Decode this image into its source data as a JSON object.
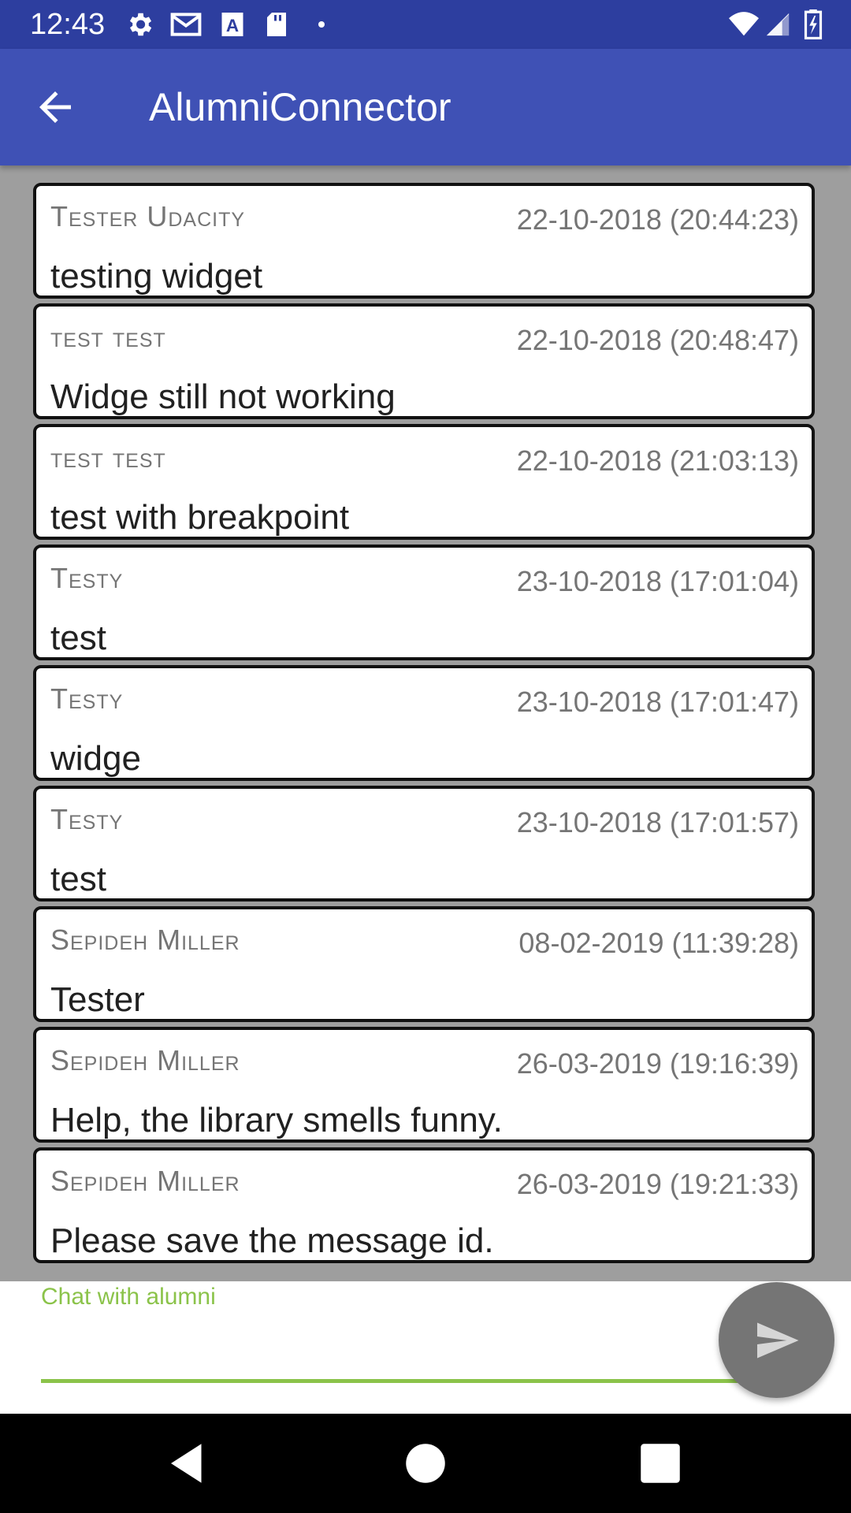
{
  "status_bar": {
    "time": "12:43",
    "icons_left": [
      "settings-icon",
      "gmail-icon",
      "font-a-icon",
      "sd-card-icon",
      "dot-icon"
    ],
    "icons_right": [
      "wifi-icon",
      "signal-icon",
      "battery-icon"
    ]
  },
  "app_bar": {
    "title": "AlumniConnector",
    "back_icon": "arrow-back-icon"
  },
  "messages": [
    {
      "author": "Tester Udacity",
      "time": "22-10-2018 (20:44:23)",
      "text": "testing widget"
    },
    {
      "author": "test test",
      "time": "22-10-2018 (20:48:47)",
      "text": "Widge still not working"
    },
    {
      "author": "test test",
      "time": "22-10-2018 (21:03:13)",
      "text": "test with breakpoint"
    },
    {
      "author": "Testy",
      "time": "23-10-2018 (17:01:04)",
      "text": "test"
    },
    {
      "author": "Testy",
      "time": "23-10-2018 (17:01:47)",
      "text": "widge"
    },
    {
      "author": "Testy",
      "time": "23-10-2018 (17:01:57)",
      "text": "test"
    },
    {
      "author": "Sepideh Miller",
      "time": "08-02-2019 (11:39:28)",
      "text": "Tester"
    },
    {
      "author": "Sepideh Miller",
      "time": "26-03-2019 (19:16:39)",
      "text": "Help, the library smells funny."
    },
    {
      "author": "Sepideh Miller",
      "time": "26-03-2019 (19:21:33)",
      "text": "Please save the message id."
    }
  ],
  "input": {
    "hint": "Chat with alumni",
    "value": ""
  },
  "send_button": {
    "icon": "send-icon"
  },
  "nav_bar": {
    "icons": [
      "nav-back-icon",
      "nav-home-icon",
      "nav-recents-icon"
    ]
  },
  "colors": {
    "status_bar": "#2d3e9f",
    "app_bar": "#3f51b5",
    "list_background": "#9e9e9e",
    "accent": "#8bc34a",
    "fab": "#757575"
  }
}
